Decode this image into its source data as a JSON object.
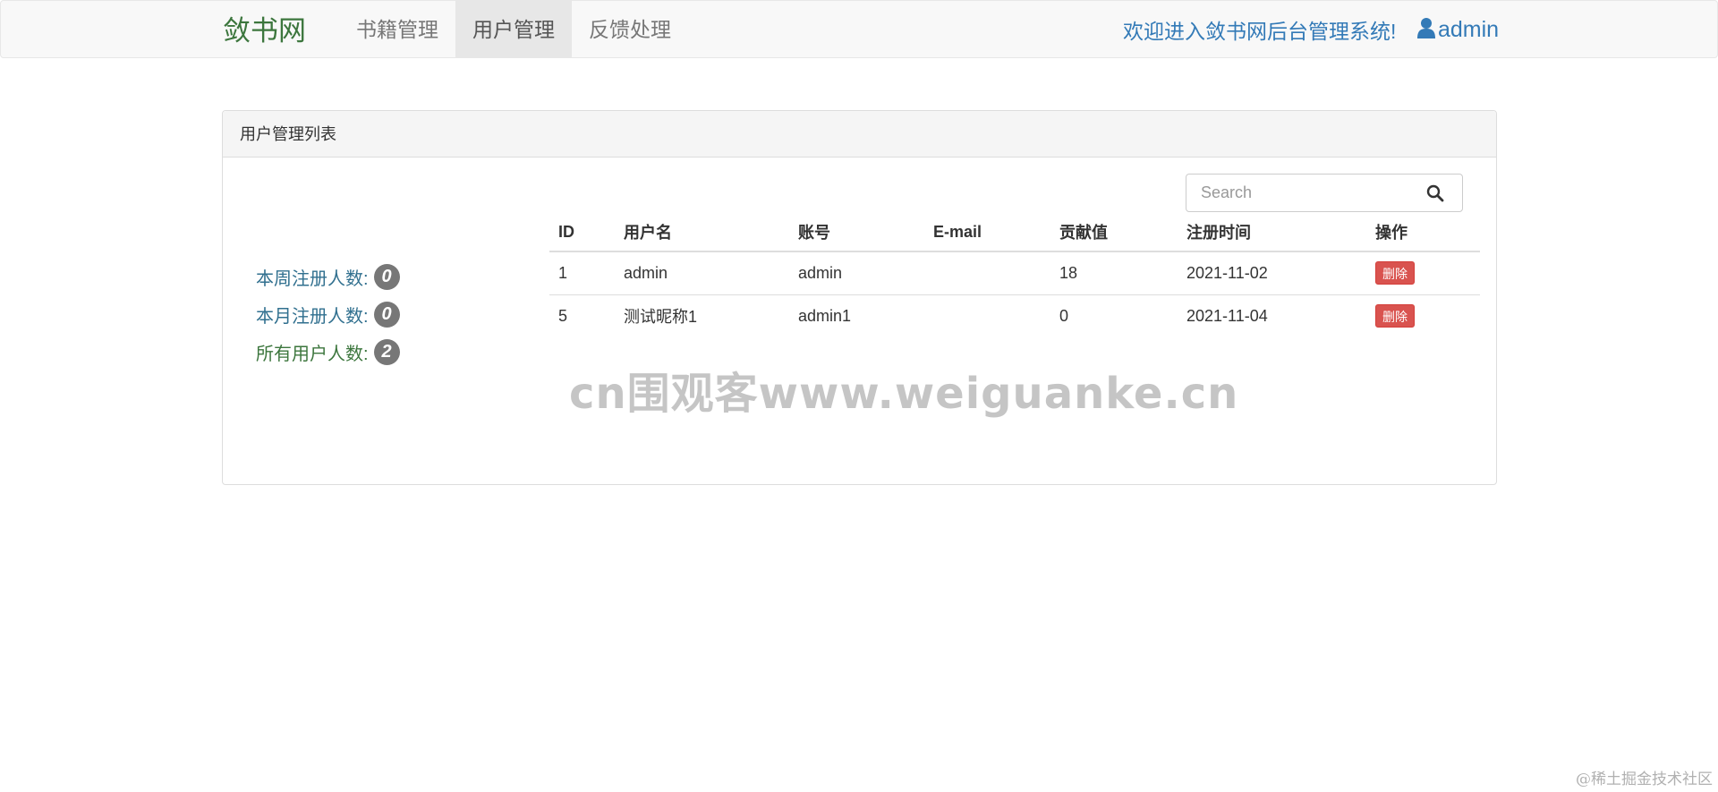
{
  "navbar": {
    "brand": "敛书网",
    "items": [
      {
        "label": "书籍管理",
        "active": false
      },
      {
        "label": "用户管理",
        "active": true
      },
      {
        "label": "反馈处理",
        "active": false
      }
    ],
    "welcome": "欢迎进入敛书网后台管理系统!",
    "user": {
      "icon": "user-icon",
      "name": "admin"
    }
  },
  "panel": {
    "title": "用户管理列表",
    "stats": [
      {
        "label": "本周注册人数:",
        "value": "0"
      },
      {
        "label": "本月注册人数:",
        "value": "0"
      },
      {
        "label": "所有用户人数:",
        "value": "2"
      }
    ],
    "search": {
      "placeholder": "Search",
      "value": "",
      "icon": "search-icon"
    },
    "table": {
      "headers": [
        "ID",
        "用户名",
        "账号",
        "E-mail",
        "贡献值",
        "注册时间",
        "操作"
      ],
      "rows": [
        {
          "id": "1",
          "username": "admin",
          "account": "admin",
          "email": "",
          "contribution": "18",
          "registered": "2021-11-02",
          "action": "删除"
        },
        {
          "id": "5",
          "username": "测试昵称1",
          "account": "admin1",
          "email": "",
          "contribution": "0",
          "registered": "2021-11-04",
          "action": "删除"
        }
      ]
    }
  },
  "watermark": "cn围观客www.weiguanke.cn",
  "corner_mark": "@稀土掘金技术社区",
  "colors": {
    "danger": "#d9534f",
    "brand": "#3c763d",
    "link": "#337ab7",
    "info": "#31708f",
    "badge": "#777777"
  }
}
